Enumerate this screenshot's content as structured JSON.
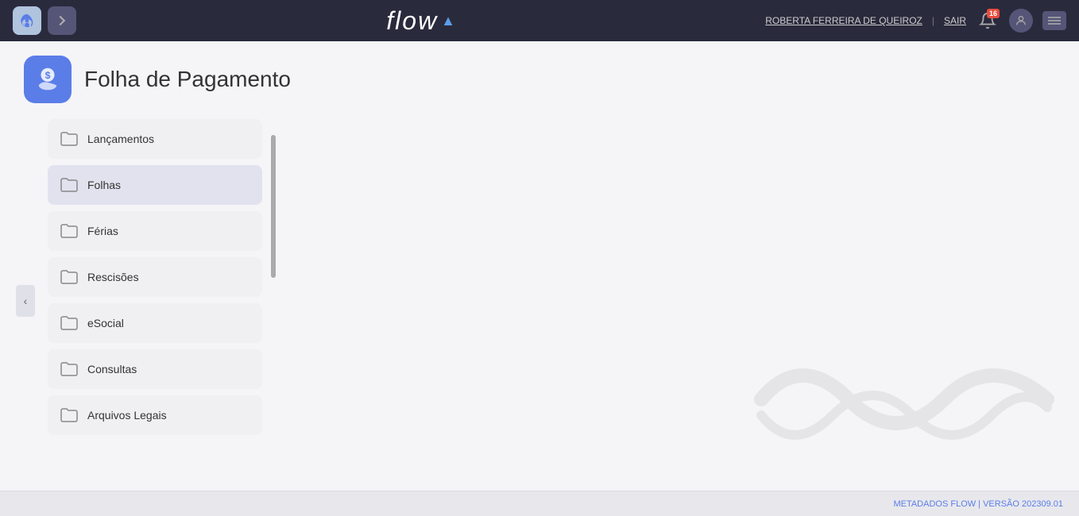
{
  "brand": {
    "name": "flow",
    "arrow_symbol": "▲"
  },
  "topnav": {
    "user_name": "ROBERTA FERREIRA DE QUEIROZ",
    "separator": "|",
    "logout_label": "SAIR",
    "notification_count": "16"
  },
  "page": {
    "title": "Folha de Pagamento"
  },
  "menu": {
    "items": [
      {
        "label": "Lançamentos",
        "active": false
      },
      {
        "label": "Folhas",
        "active": true
      },
      {
        "label": "Férias",
        "active": false
      },
      {
        "label": "Rescisões",
        "active": false
      },
      {
        "label": "eSocial",
        "active": false
      },
      {
        "label": "Consultas",
        "active": false
      },
      {
        "label": "Arquivos Legais",
        "active": false
      }
    ]
  },
  "footer": {
    "text": "METADADOS FLOW | VERSÃO 202309.01"
  },
  "collapse_btn": {
    "icon": "‹"
  }
}
